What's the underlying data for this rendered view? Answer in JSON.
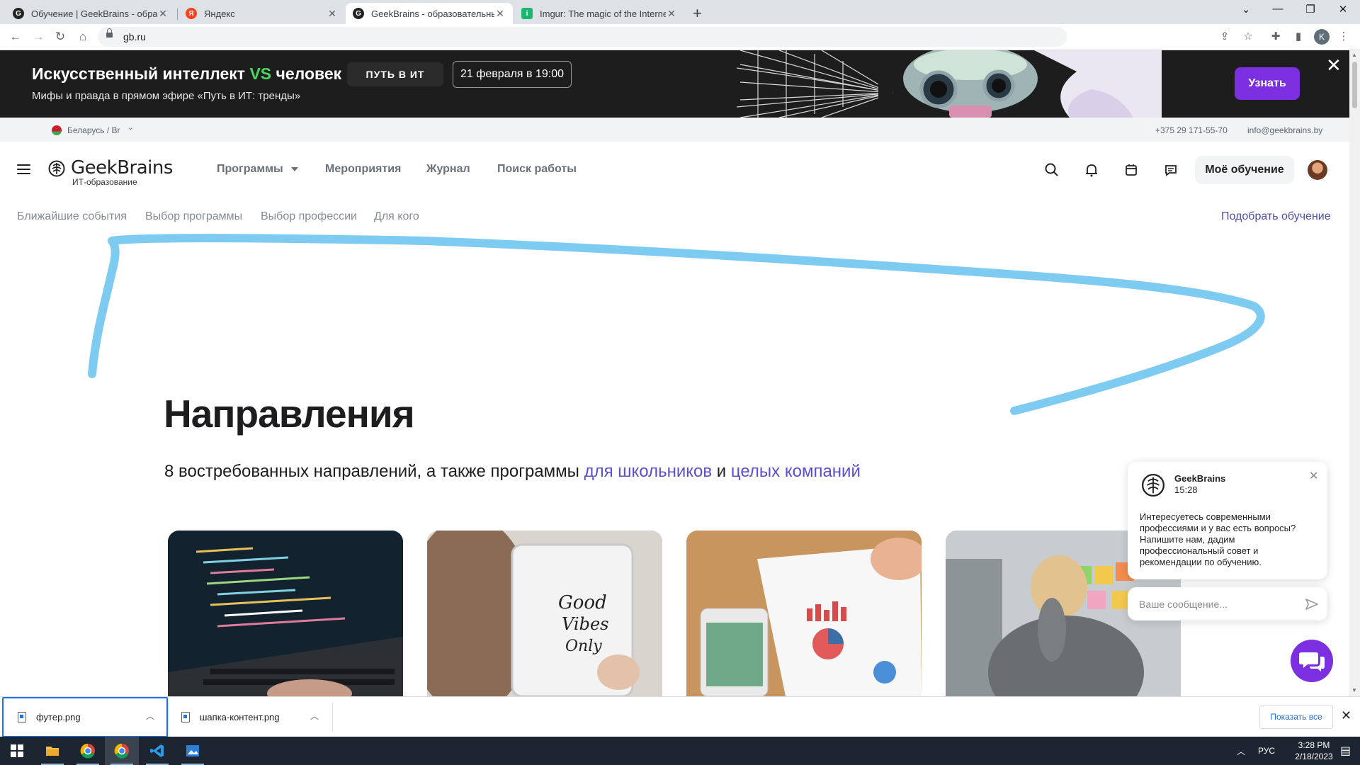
{
  "browser": {
    "tabs": [
      {
        "title": "Обучение | GeekBrains - образо",
        "favicon": "geekbrains-icon",
        "active": false
      },
      {
        "title": "Яндекс",
        "favicon": "yandex-icon",
        "active": false
      },
      {
        "title": "GeekBrains - образовательный",
        "favicon": "geekbrains-icon",
        "active": true
      },
      {
        "title": "Imgur: The magic of the Internet",
        "favicon": "imgur-icon",
        "active": false
      }
    ],
    "url": "gb.ru",
    "profile_initial": "K"
  },
  "promo": {
    "title_part1": "Искусственный интеллект ",
    "title_vs": "VS",
    "title_part2": " человек",
    "subtitle": "Мифы и правда в прямом эфире «Путь в ИТ: тренды»",
    "logo": "ПУТЬ В ИТ",
    "date": "21 февраля в 19:00",
    "button": "Узнать"
  },
  "utility": {
    "region": "Беларусь / Br",
    "phone": "+375 29 171-55-70",
    "email": "info@geekbrains.by"
  },
  "header": {
    "logo_name": "GeekBrains",
    "logo_tagline": "ИТ-образование",
    "nav": [
      "Программы",
      "Мероприятия",
      "Журнал",
      "Поиск работы"
    ],
    "my_learning": "Моё обучение"
  },
  "subnav": {
    "items": [
      "Ближайшие события",
      "Выбор программы",
      "Выбор профессии",
      "Для кого"
    ],
    "right_link": "Подобрать обучение"
  },
  "content": {
    "heading": "Направления",
    "lead_text": "8 востребованных направлений, а также программы ",
    "lead_link1": "для школьников",
    "lead_and": " и ",
    "lead_link2": "целых компаний"
  },
  "chat": {
    "sender": "GeekBrains",
    "time": "15:28",
    "message": "Интересуетесь современными профессиями и у вас есть вопросы? Напишите нам, дадим профессиональный совет и рекомендации по обучению.",
    "input_placeholder": "Ваше сообщение..."
  },
  "downloads": {
    "items": [
      "футер.png",
      "шапка-контент.png"
    ],
    "show_all": "Показать все"
  },
  "taskbar": {
    "language": "РУС",
    "time": "3:28 PM",
    "date": "2/18/2023"
  },
  "colors": {
    "accent": "#7b2fe0",
    "link": "#5a4fcf",
    "vs_green": "#4bd663",
    "scribble": "#7ecbf2"
  }
}
